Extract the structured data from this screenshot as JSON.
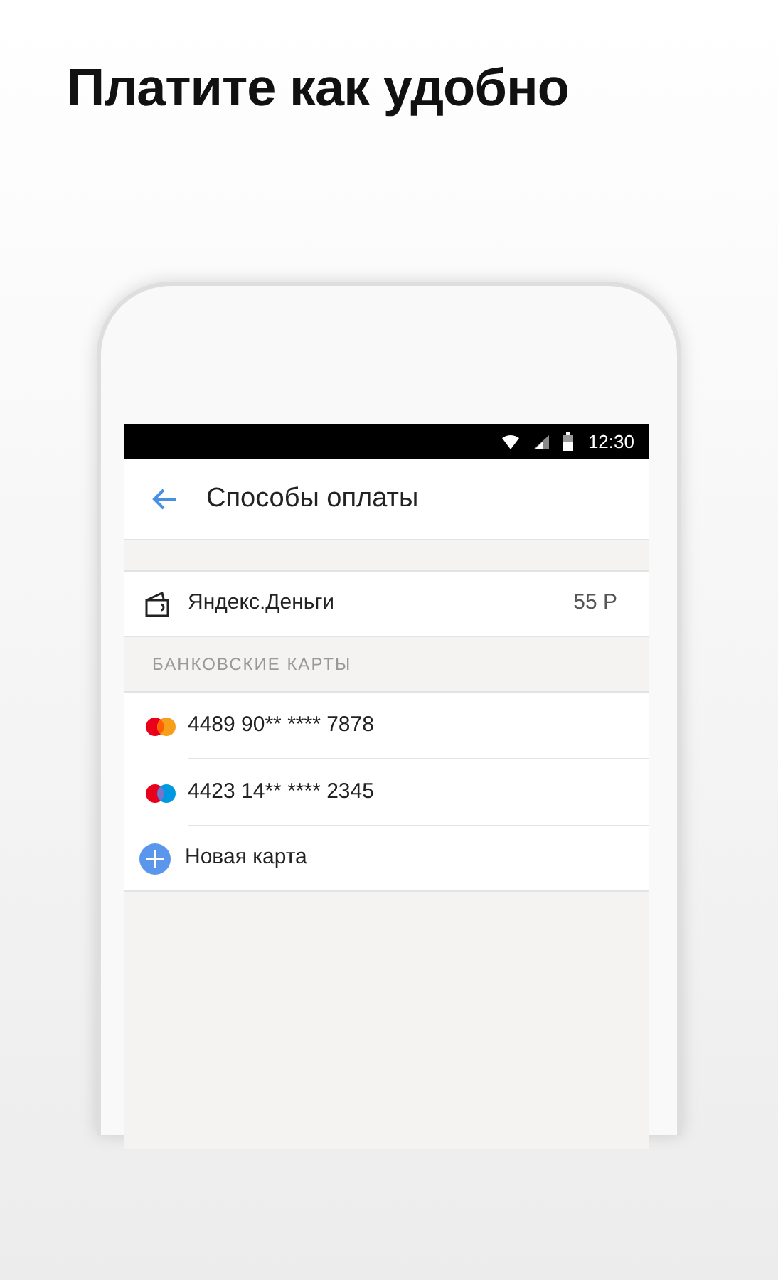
{
  "headline": "Платите как удобно",
  "status_bar": {
    "time": "12:30"
  },
  "toolbar": {
    "title": "Способы оплаты"
  },
  "wallet": {
    "name": "Яндекс.Деньги",
    "balance": "55 Р"
  },
  "section_header": "БАНКОВСКИЕ КАРТЫ",
  "cards": [
    {
      "kind": "mastercard",
      "number": "4489 90** **** 7878"
    },
    {
      "kind": "maestro",
      "number": "4423 14** **** 2345"
    }
  ],
  "add_card": {
    "label": "Новая карта"
  }
}
